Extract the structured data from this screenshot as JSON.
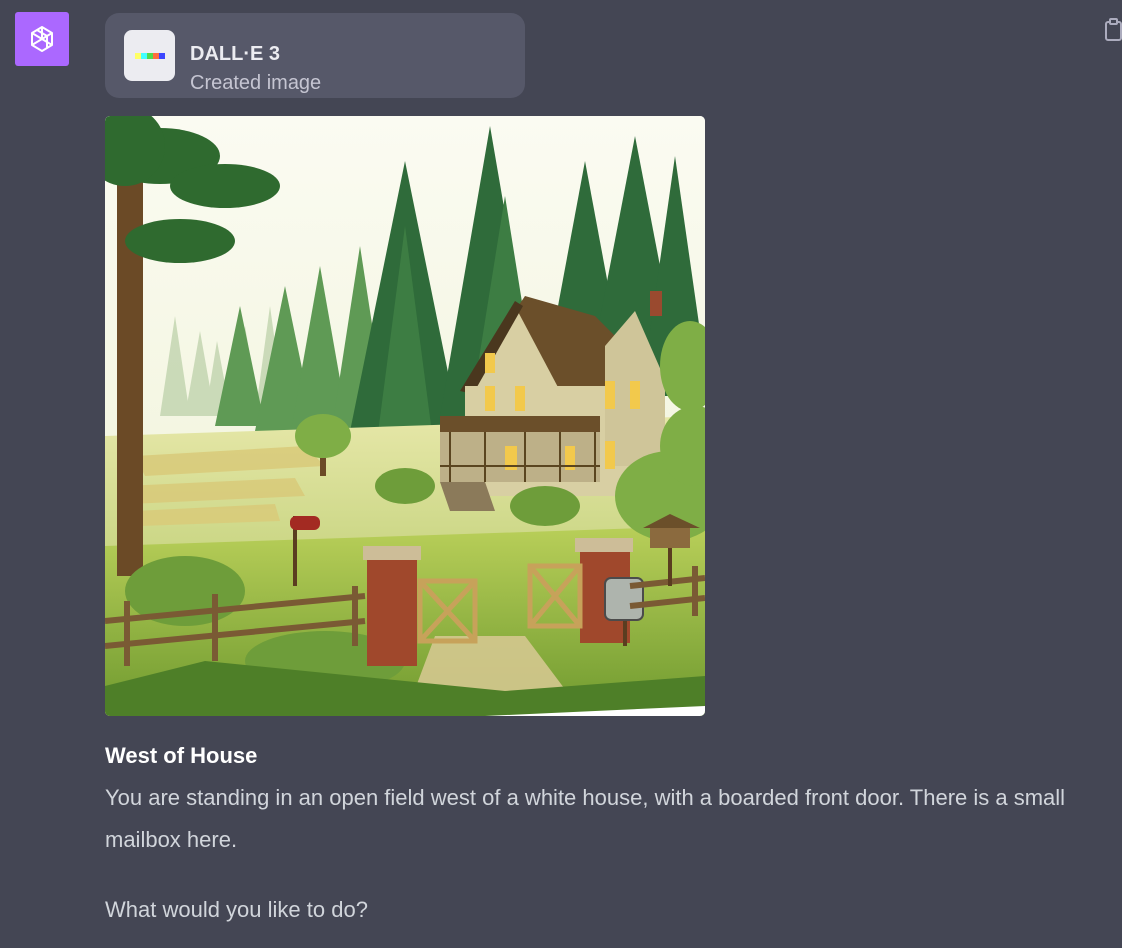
{
  "assistant": {
    "avatar_icon": "openai-logo-icon",
    "avatar_color": "#ab68ff"
  },
  "tool_call": {
    "title": "DALL·E 3",
    "subtitle": "Created image",
    "icon": "dalle-rainbow-icon",
    "rainbow_colors": [
      "#ffff66",
      "#42ffff",
      "#51da4c",
      "#ff6e3c",
      "#3c46ff"
    ]
  },
  "message": {
    "heading": "West of House",
    "body": "You are standing in an open field west of a white house, with a boarded front door. There is a small mailbox here.",
    "question": "What would you like to do?"
  },
  "actions": {
    "copy_icon": "clipboard-icon"
  }
}
